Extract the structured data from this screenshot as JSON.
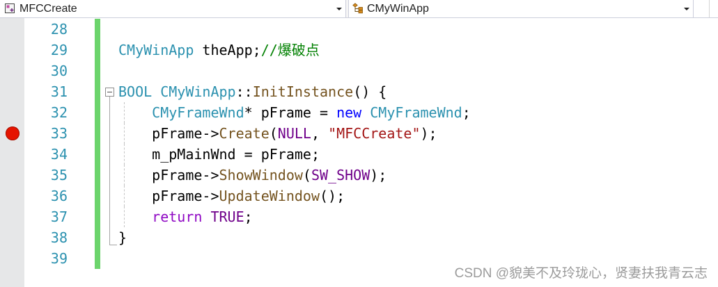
{
  "navbar": {
    "project_dropdown": {
      "value": "MFCCreate",
      "icon": "project-icon"
    },
    "type_dropdown": {
      "value": "CMyWinApp",
      "icon": "class-icon"
    }
  },
  "editor": {
    "colors": {
      "line_number": "#2b91af",
      "change_bar": "#6cd46c",
      "breakpoint": "#e51400",
      "glyph_margin": "#e6e7e8",
      "outline": "#a5a5a5",
      "indent_guide": "#c4c4c4"
    },
    "lines": [
      {
        "number": "28",
        "tokens": []
      },
      {
        "number": "29",
        "tokens": [
          {
            "text": "CMyWinApp",
            "color": "#2b91af"
          },
          {
            "text": " theApp;"
          },
          {
            "text": "//爆破点",
            "color": "#008000"
          }
        ]
      },
      {
        "number": "30",
        "tokens": []
      },
      {
        "number": "31",
        "outline_icon": "collapse-minus-icon",
        "tokens": [
          {
            "text": "BOOL",
            "color": "#2b91af"
          },
          {
            "text": " "
          },
          {
            "text": "CMyWinApp",
            "color": "#2b91af"
          },
          {
            "text": "::"
          },
          {
            "text": "InitInstance",
            "color": "#74531f"
          },
          {
            "text": "() {"
          }
        ]
      },
      {
        "number": "32",
        "outline_icon": "outline-line-icon",
        "tokens": [
          {
            "text": "    "
          },
          {
            "text": "CMyFrameWnd",
            "color": "#2b91af"
          },
          {
            "text": "* pFrame = "
          },
          {
            "text": "new",
            "color": "#0000ff"
          },
          {
            "text": " "
          },
          {
            "text": "CMyFrameWnd",
            "color": "#2b91af"
          },
          {
            "text": ";"
          }
        ]
      },
      {
        "number": "33",
        "breakpoint": true,
        "outline_icon": "outline-line-icon",
        "tokens": [
          {
            "text": "    pFrame->"
          },
          {
            "text": "Create",
            "color": "#74531f"
          },
          {
            "text": "("
          },
          {
            "text": "NULL",
            "color": "#6f008a"
          },
          {
            "text": ", "
          },
          {
            "text": "\"MFCCreate\"",
            "color": "#a31515"
          },
          {
            "text": ");"
          }
        ]
      },
      {
        "number": "34",
        "outline_icon": "outline-line-icon",
        "tokens": [
          {
            "text": "    m_pMainWnd = pFrame;"
          }
        ]
      },
      {
        "number": "35",
        "outline_icon": "outline-line-icon",
        "tokens": [
          {
            "text": "    pFrame->"
          },
          {
            "text": "ShowWindow",
            "color": "#74531f"
          },
          {
            "text": "("
          },
          {
            "text": "SW_SHOW",
            "color": "#6f008a"
          },
          {
            "text": ");"
          }
        ]
      },
      {
        "number": "36",
        "outline_icon": "outline-line-icon",
        "tokens": [
          {
            "text": "    pFrame->"
          },
          {
            "text": "UpdateWindow",
            "color": "#74531f"
          },
          {
            "text": "();"
          }
        ]
      },
      {
        "number": "37",
        "outline_icon": "outline-line-icon",
        "tokens": [
          {
            "text": "    "
          },
          {
            "text": "return",
            "color": "#8f08c4"
          },
          {
            "text": " "
          },
          {
            "text": "TRUE",
            "color": "#6f008a"
          },
          {
            "text": ";"
          }
        ]
      },
      {
        "number": "38",
        "outline_icon": "outline-end-icon",
        "tokens": [
          {
            "text": "}"
          }
        ]
      },
      {
        "number": "39",
        "tokens": []
      }
    ]
  },
  "watermark": "CSDN @貌美不及玲珑心，贤妻扶我青云志"
}
